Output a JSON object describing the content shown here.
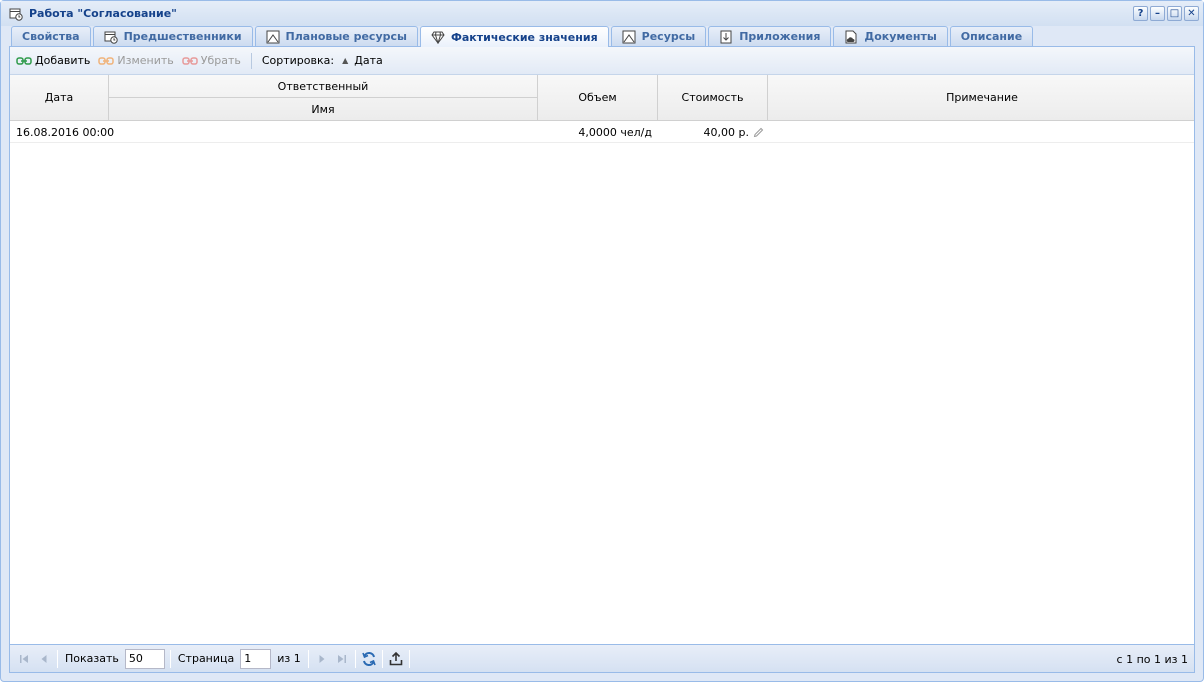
{
  "window": {
    "title": "Работа \"Согласование\"",
    "tools": [
      "?",
      "–",
      "□",
      "✕"
    ]
  },
  "tabs": [
    {
      "label": "Свойства",
      "icon": "",
      "active": false
    },
    {
      "label": "Предшественники",
      "icon": "calendar-clock-icon",
      "active": false
    },
    {
      "label": "Плановые ресурсы",
      "icon": "resource-chart-icon",
      "active": false
    },
    {
      "label": "Фактические значения",
      "icon": "diamond-icon",
      "active": true
    },
    {
      "label": "Ресурсы",
      "icon": "resource-chart-icon",
      "active": false
    },
    {
      "label": "Приложения",
      "icon": "download-icon",
      "active": false
    },
    {
      "label": "Документы",
      "icon": "cloud-document-icon",
      "active": false
    },
    {
      "label": "Описание",
      "icon": "",
      "active": false
    }
  ],
  "toolbar": {
    "add_label": "Добавить",
    "edit_label": "Изменить",
    "remove_label": "Убрать",
    "sort_label": "Сортировка:",
    "sort_field": "Дата"
  },
  "grid": {
    "headers": {
      "date": "Дата",
      "responsible": "Ответственный",
      "name": "Имя",
      "volume": "Объем",
      "cost": "Стоимость",
      "note": "Примечание"
    },
    "rows": [
      {
        "date": "16.08.2016 00:00",
        "name": "",
        "volume": "4,0000 чел/д",
        "cost": "40,00 р.",
        "note": ""
      }
    ]
  },
  "pager": {
    "show_label": "Показать",
    "page_size": "50",
    "page_label": "Страница",
    "page_value": "1",
    "of_label": "из 1",
    "info": "с 1 по 1 из 1"
  }
}
